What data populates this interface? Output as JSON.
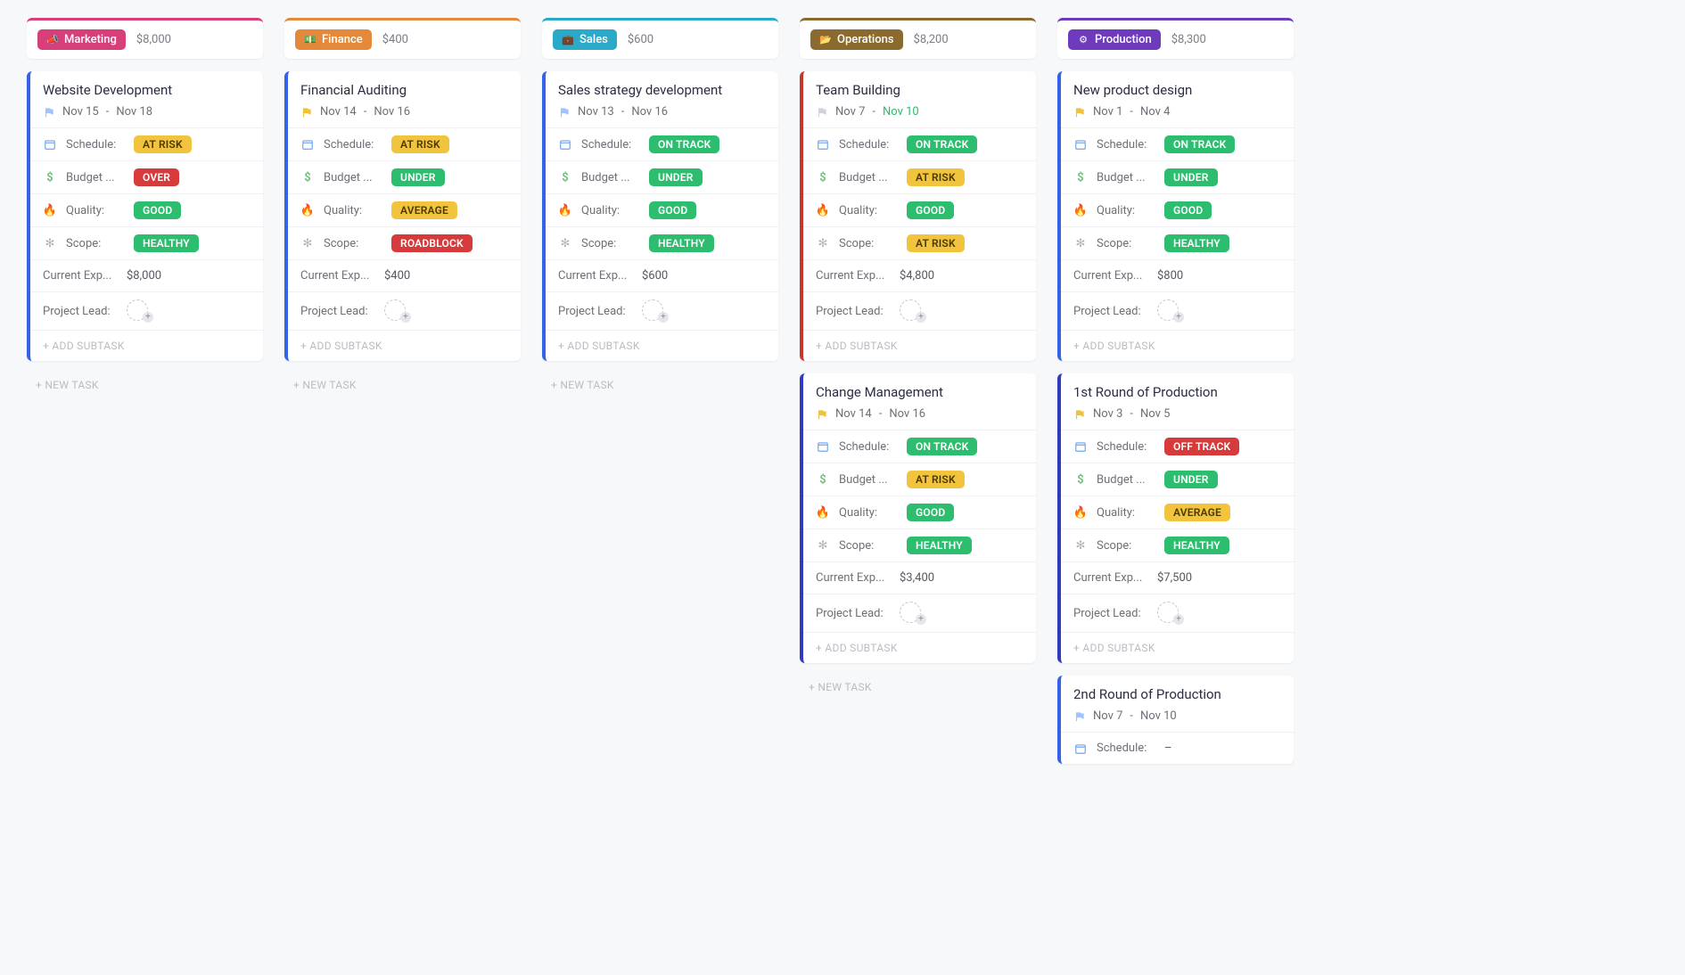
{
  "labels": {
    "schedule": "Schedule:",
    "budget": "Budget ...",
    "quality": "Quality:",
    "scope": "Scope:",
    "current_exp": "Current Exp...",
    "project_lead": "Project Lead:",
    "add_subtask": "+ ADD SUBTASK",
    "new_task": "+ NEW TASK",
    "date_sep": "-"
  },
  "badge_colors": {
    "ON TRACK": "b-green",
    "OFF TRACK": "b-red",
    "AT RISK": "b-yellow",
    "OVER": "b-red",
    "UNDER": "b-green",
    "GOOD": "b-green",
    "AVERAGE": "b-yellow",
    "HEALTHY": "b-green",
    "ROADBLOCK": "b-red"
  },
  "columns": [
    {
      "name": "Marketing",
      "pill_color": "#d63f7a",
      "header_border": "#d63f7a",
      "pill_icon": "📣",
      "amount": "$8,000",
      "show_new_task_after": 1,
      "cards": [
        {
          "title": "Website Development",
          "accent": "#3263e8",
          "flag": "blue",
          "date_start": "Nov 15",
          "date_end": "Nov 18",
          "schedule": "AT RISK",
          "budget": "OVER",
          "quality": "GOOD",
          "scope": "HEALTHY",
          "current_exp": "$8,000",
          "project_lead": null
        }
      ]
    },
    {
      "name": "Finance",
      "pill_color": "#e4893c",
      "header_border": "#e4893c",
      "pill_icon": "💵",
      "amount": "$400",
      "show_new_task_after": 1,
      "cards": [
        {
          "title": "Financial Auditing",
          "accent": "#3263e8",
          "flag": "yellow",
          "date_start": "Nov 14",
          "date_end": "Nov 16",
          "schedule": "AT RISK",
          "budget": "UNDER",
          "quality": "AVERAGE",
          "scope": "ROADBLOCK",
          "current_exp": "$400",
          "project_lead": null
        }
      ]
    },
    {
      "name": "Sales",
      "pill_color": "#2aa9c9",
      "header_border": "#2aa9c9",
      "pill_icon": "💼",
      "amount": "$600",
      "show_new_task_after": 1,
      "cards": [
        {
          "title": "Sales strategy development",
          "accent": "#3263e8",
          "flag": "blue",
          "date_start": "Nov 13",
          "date_end": "Nov 16",
          "schedule": "ON TRACK",
          "budget": "UNDER",
          "quality": "GOOD",
          "scope": "HEALTHY",
          "current_exp": "$600",
          "project_lead": null
        }
      ]
    },
    {
      "name": "Operations",
      "pill_color": "#8a6a2f",
      "header_border": "#8a6a2f",
      "pill_icon": "📂",
      "amount": "$8,200",
      "show_new_task_after": 2,
      "cards": [
        {
          "title": "Team Building",
          "accent": "#c8362b",
          "flag": "gray",
          "date_start": "Nov 7",
          "date_end": "Nov 10",
          "date_end_style": "green",
          "schedule": "ON TRACK",
          "budget": "AT RISK",
          "quality": "GOOD",
          "scope": "AT RISK",
          "current_exp": "$4,800",
          "project_lead": null
        },
        {
          "title": "Change Management",
          "accent": "#2f3ac0",
          "flag": "yellow",
          "date_start": "Nov 14",
          "date_end": "Nov 16",
          "schedule": "ON TRACK",
          "budget": "AT RISK",
          "quality": "GOOD",
          "scope": "HEALTHY",
          "current_exp": "$3,400",
          "project_lead": null
        }
      ]
    },
    {
      "name": "Production",
      "pill_color": "#6f3bbd",
      "header_border": "#6f3bbd",
      "pill_icon": "⚙",
      "amount": "$8,300",
      "show_new_task_after": 99,
      "cards": [
        {
          "title": "New product design",
          "accent": "#3263e8",
          "flag": "yellow",
          "date_start": "Nov 1",
          "date_end": "Nov 4",
          "schedule": "ON TRACK",
          "budget": "UNDER",
          "quality": "GOOD",
          "scope": "HEALTHY",
          "current_exp": "$800",
          "project_lead": null
        },
        {
          "title": "1st Round of Production",
          "accent": "#2f3ac0",
          "flag": "yellow",
          "date_start": "Nov 3",
          "date_end": "Nov 5",
          "schedule": "OFF TRACK",
          "budget": "UNDER",
          "quality": "AVERAGE",
          "scope": "HEALTHY",
          "current_exp": "$7,500",
          "project_lead": null
        },
        {
          "title": "2nd Round of Production",
          "accent": "#3263e8",
          "flag": "blue",
          "date_start": "Nov 7",
          "date_end": "Nov 10",
          "schedule": "–",
          "truncated": true
        }
      ]
    }
  ]
}
